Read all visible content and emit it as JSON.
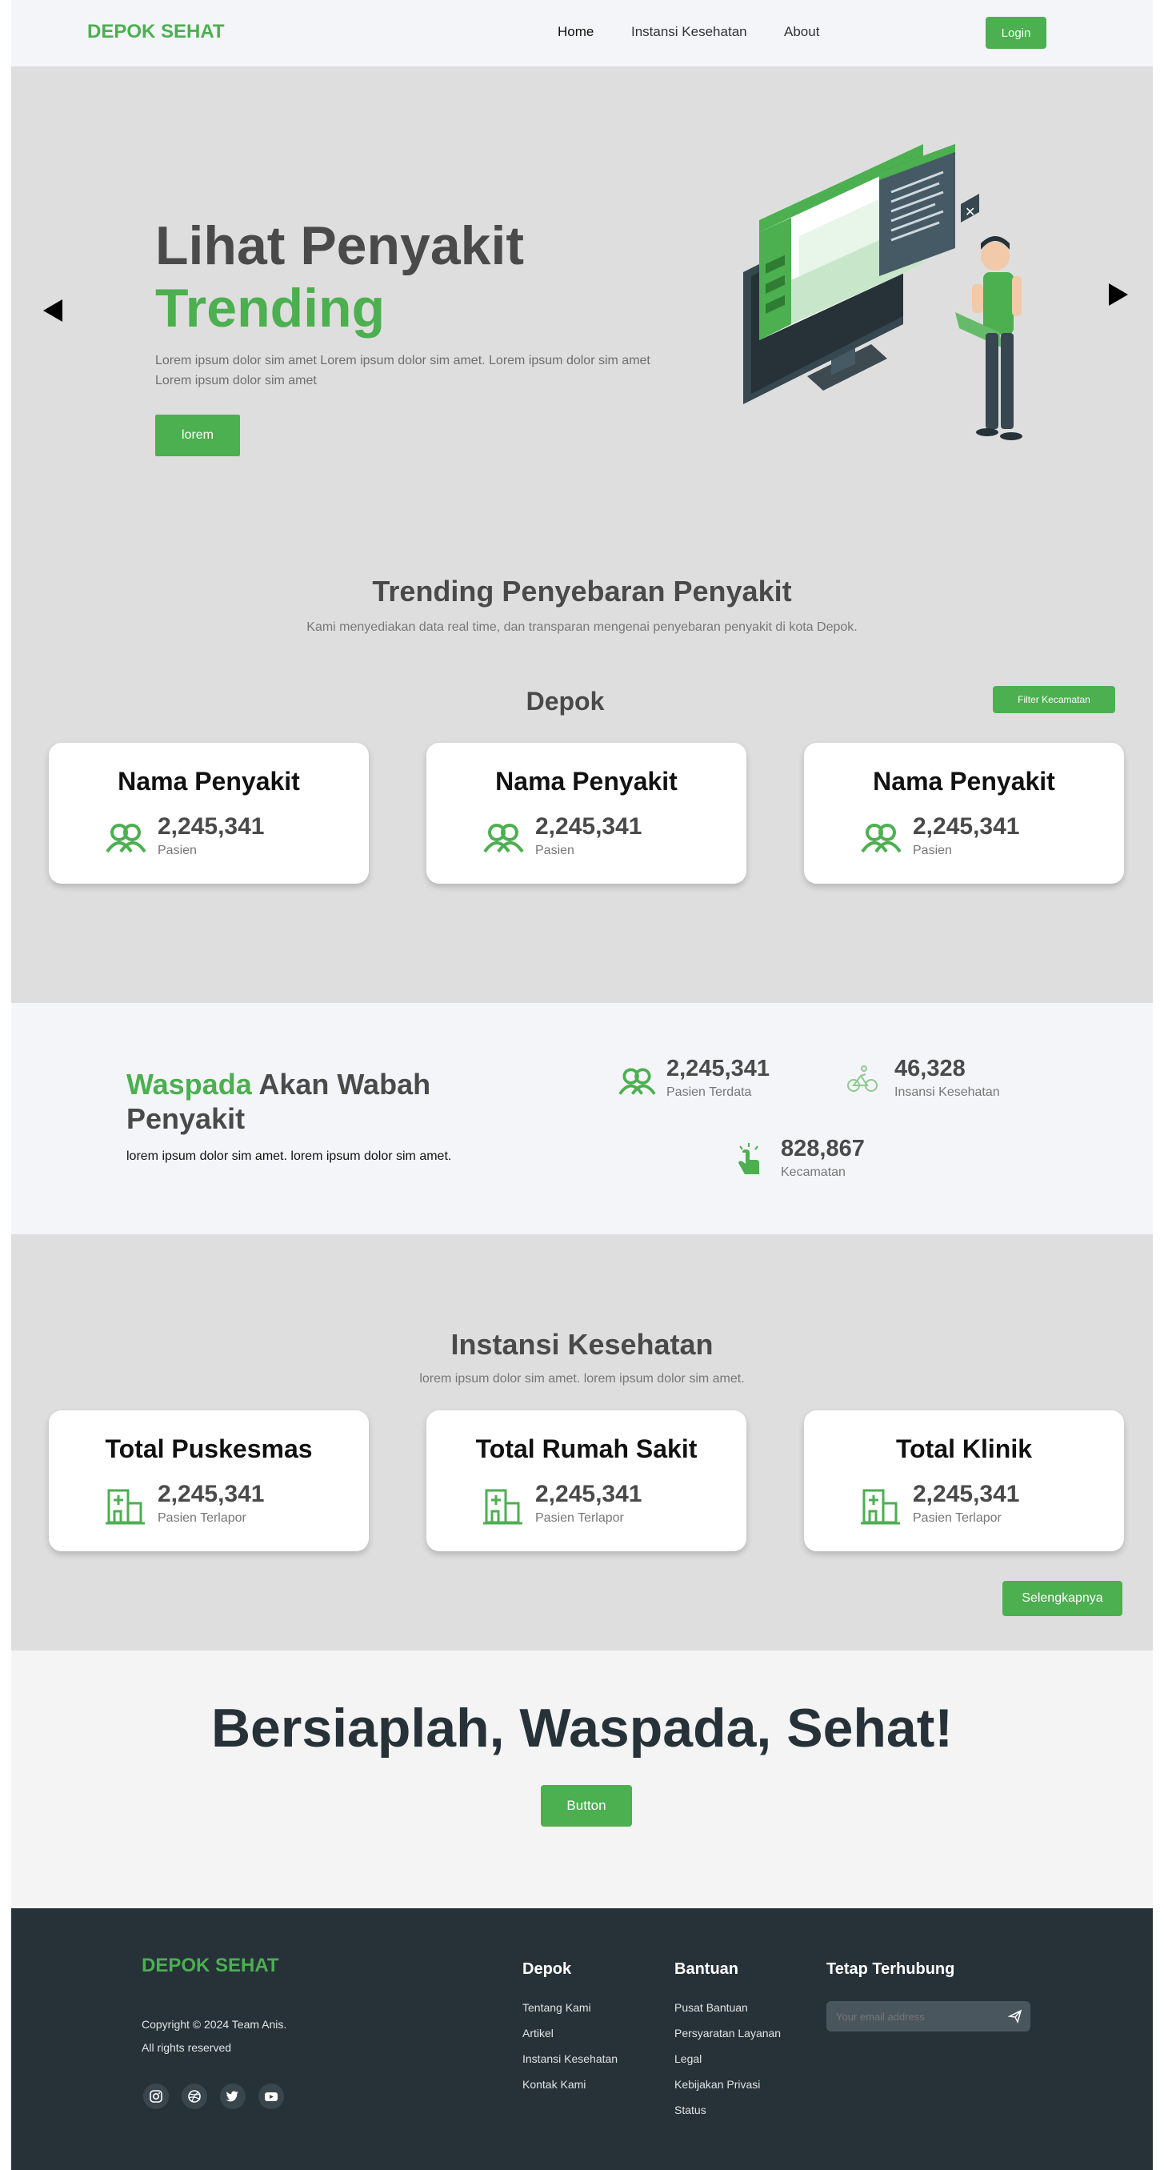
{
  "nav": {
    "logo": "DEPOK SEHAT",
    "links": [
      "Home",
      "Instansi Kesehatan",
      "About"
    ],
    "login": "Login"
  },
  "hero": {
    "title_line1": "Lihat Penyakit",
    "title_line2": "Trending",
    "description": "Lorem ipsum dolor sim amet Lorem ipsum dolor sim amet. Lorem ipsum dolor sim amet Lorem ipsum dolor sim amet",
    "button": "lorem"
  },
  "trending": {
    "title": "Trending Penyebaran Penyakit",
    "subtitle": "Kami menyediakan data real time, dan transparan mengenai penyebaran penyakit di kota Depok.",
    "region": "Depok",
    "filter_button": "Filter Kecamatan",
    "cards": [
      {
        "title": "Nama Penyakit",
        "value": "2,245,341",
        "label": "Pasien"
      },
      {
        "title": "Nama Penyakit",
        "value": "2,245,341",
        "label": "Pasien"
      },
      {
        "title": "Nama Penyakit",
        "value": "2,245,341",
        "label": "Pasien"
      }
    ]
  },
  "waspada": {
    "highlight": "Waspada",
    "title_rest": " Akan Wabah",
    "title_line2": "Penyakit",
    "description": "lorem ipsum dolor sim amet. lorem ipsum dolor sim amet.",
    "stats": [
      {
        "value": "2,245,341",
        "label": "Pasien Terdata",
        "icon": "users-icon"
      },
      {
        "value": "46,328",
        "label": "Insansi Kesehatan",
        "icon": "bicycle-icon"
      },
      {
        "value": "828,867",
        "label": "Kecamatan",
        "icon": "hand-click-icon"
      }
    ]
  },
  "instansi": {
    "title": "Instansi Kesehatan",
    "subtitle": "lorem ipsum dolor sim amet. lorem ipsum dolor sim amet.",
    "cards": [
      {
        "title": "Total Puskesmas",
        "value": "2,245,341",
        "label": "Pasien Terlapor"
      },
      {
        "title": "Total Rumah Sakit",
        "value": "2,245,341",
        "label": "Pasien Terlapor"
      },
      {
        "title": "Total Klinik",
        "value": "2,245,341",
        "label": "Pasien Terlapor"
      }
    ],
    "more_button": "Selengkapnya"
  },
  "cta": {
    "title": "Bersiaplah, Waspada, Sehat!",
    "button": "Button"
  },
  "footer": {
    "logo": "DEPOK SEHAT",
    "copyright": "Copyright © 2024 Team Anis.",
    "rights": "All rights reserved",
    "col1": {
      "title": "Depok",
      "links": [
        "Tentang Kami",
        "Artikel",
        "Instansi Kesehatan",
        "Kontak Kami"
      ]
    },
    "col2": {
      "title": "Bantuan",
      "links": [
        "Pusat Bantuan",
        "Persyaratan Layanan",
        "Legal",
        "Kebijakan Privasi",
        "Status"
      ]
    },
    "col3": {
      "title": "Tetap Terhubung",
      "email_placeholder": "Your email address"
    },
    "socials": [
      "instagram-icon",
      "dribbble-icon",
      "twitter-icon",
      "youtube-icon"
    ]
  },
  "colors": {
    "accent": "#4CAF50",
    "dark": "#263238",
    "text": "#4a4a4a"
  }
}
